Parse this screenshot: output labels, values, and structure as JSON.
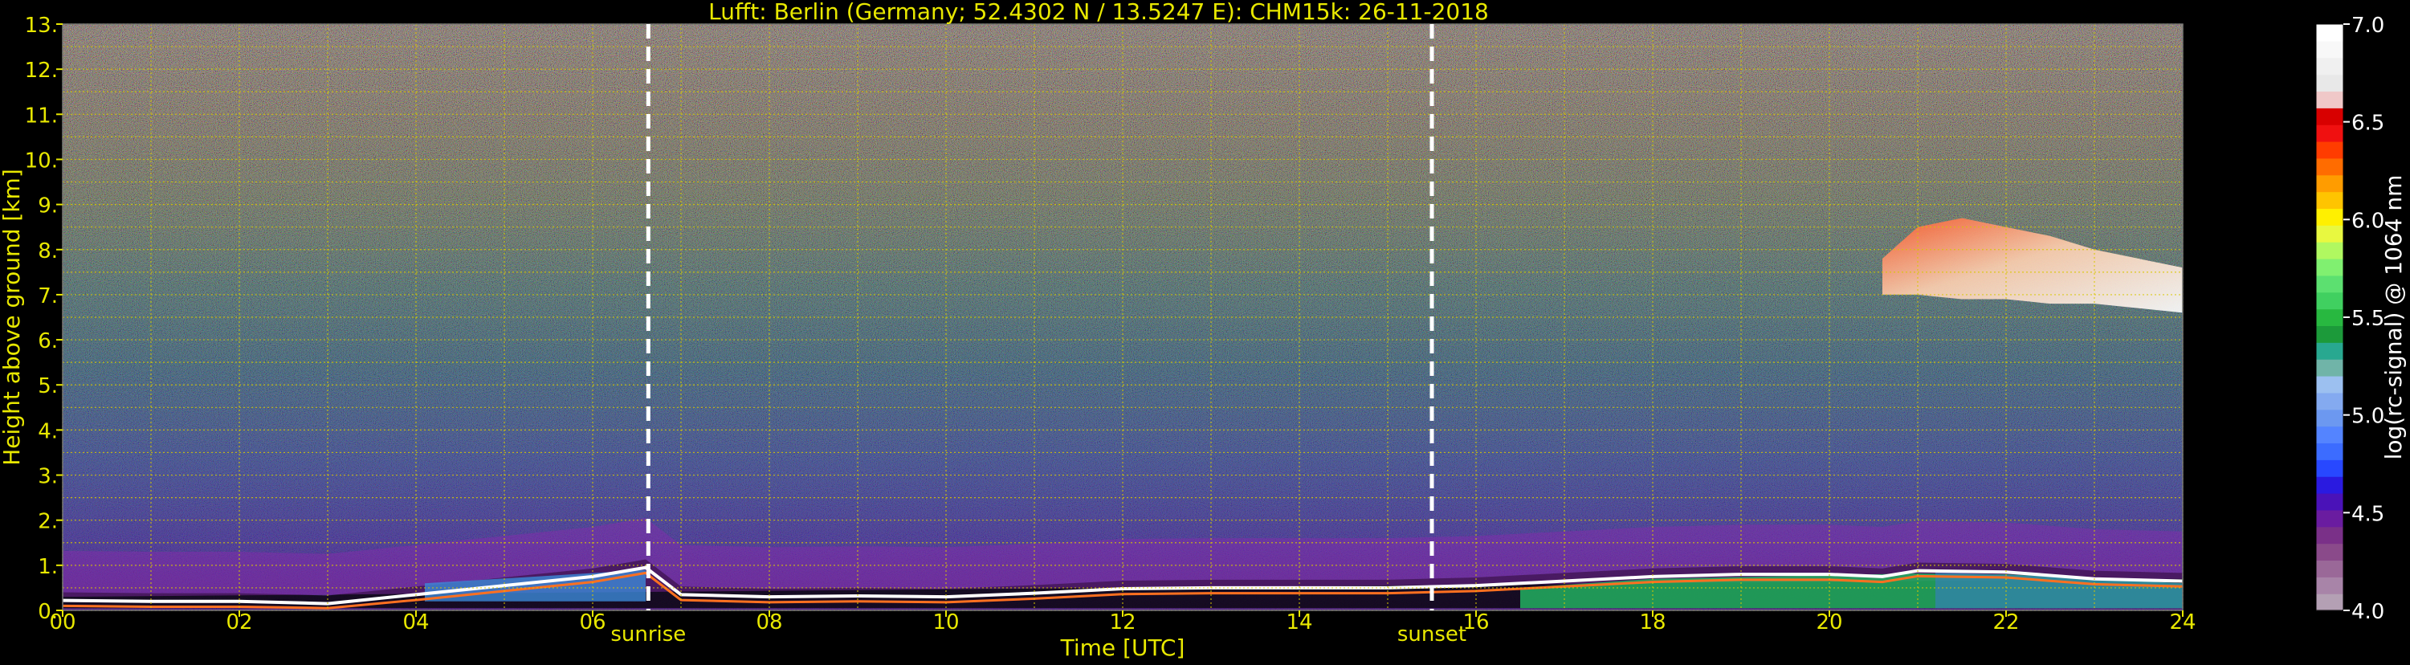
{
  "chart_data": {
    "type": "heatmap",
    "title": "Lufft: Berlin (Germany; 52.4302 N / 13.5247 E):    CHM15k: 26-11-2018",
    "xlabel": "Time [UTC]",
    "ylabel": "Height above ground [km]",
    "xlim": [
      0,
      24
    ],
    "ylim": [
      0,
      13
    ],
    "x_ticks": [
      "00",
      "02",
      "04",
      "06",
      "08",
      "10",
      "12",
      "14",
      "16",
      "18",
      "20",
      "22",
      "24"
    ],
    "y_ticks": [
      "0.",
      "1.",
      "2.",
      "3.",
      "4.",
      "5.",
      "6.",
      "7.",
      "8.",
      "9.",
      "10.",
      "11.",
      "12.",
      "13."
    ],
    "grid": true,
    "colorbar": {
      "label": "log(rc-signal) @ 1064 nm",
      "range": [
        4.0,
        7.0
      ],
      "ticks": [
        "4.0",
        "4.5",
        "5.0",
        "5.5",
        "6.0",
        "6.5",
        "7.0"
      ],
      "colors": [
        "#b4a0b4",
        "#a884a8",
        "#9a6898",
        "#8a4a8a",
        "#7a3088",
        "#6a1ca0",
        "#4a12b8",
        "#2a1ae0",
        "#2848ff",
        "#3c6cff",
        "#5484ff",
        "#6c98f0",
        "#84aaf0",
        "#9cc0f0",
        "#70b4a8",
        "#28a890",
        "#1c9a3a",
        "#28b840",
        "#40d060",
        "#5ce070",
        "#80f070",
        "#b0f860",
        "#e8f840",
        "#fff000",
        "#ffc400",
        "#ff9c00",
        "#ff6c00",
        "#ff3c00",
        "#f01010",
        "#d80000",
        "#f0c8c8",
        "#e8e8e8",
        "#f0f0f0",
        "#f8f8f8",
        "#ffffff"
      ]
    },
    "markers": [
      {
        "label": "sunrise",
        "x": 6.63
      },
      {
        "label": "sunset",
        "x": 15.5
      }
    ],
    "layers": [
      {
        "name": "boundary layer top",
        "x": [
          0,
          1,
          2,
          3,
          4,
          5,
          6,
          6.6,
          7,
          8,
          9,
          10,
          11,
          12,
          13,
          14,
          15,
          16,
          17,
          18,
          19,
          20,
          20.6,
          21,
          22,
          23,
          24
        ],
        "y": [
          0.22,
          0.2,
          0.2,
          0.15,
          0.35,
          0.55,
          0.75,
          0.95,
          0.35,
          0.3,
          0.32,
          0.3,
          0.38,
          0.48,
          0.5,
          0.5,
          0.5,
          0.55,
          0.65,
          0.75,
          0.8,
          0.8,
          0.75,
          0.88,
          0.85,
          0.7,
          0.65
        ]
      },
      {
        "name": "cirrus cloud base",
        "x": [
          20.6,
          21,
          21.5,
          22,
          22.5,
          23,
          23.5,
          24
        ],
        "y": [
          7.0,
          7.0,
          6.9,
          6.9,
          6.8,
          6.8,
          6.7,
          6.6
        ]
      },
      {
        "name": "cirrus cloud top",
        "x": [
          20.6,
          21,
          21.5,
          22,
          22.5,
          23,
          23.5,
          24
        ],
        "y": [
          7.8,
          8.5,
          8.7,
          8.5,
          8.3,
          8.0,
          7.8,
          7.6
        ]
      }
    ]
  }
}
